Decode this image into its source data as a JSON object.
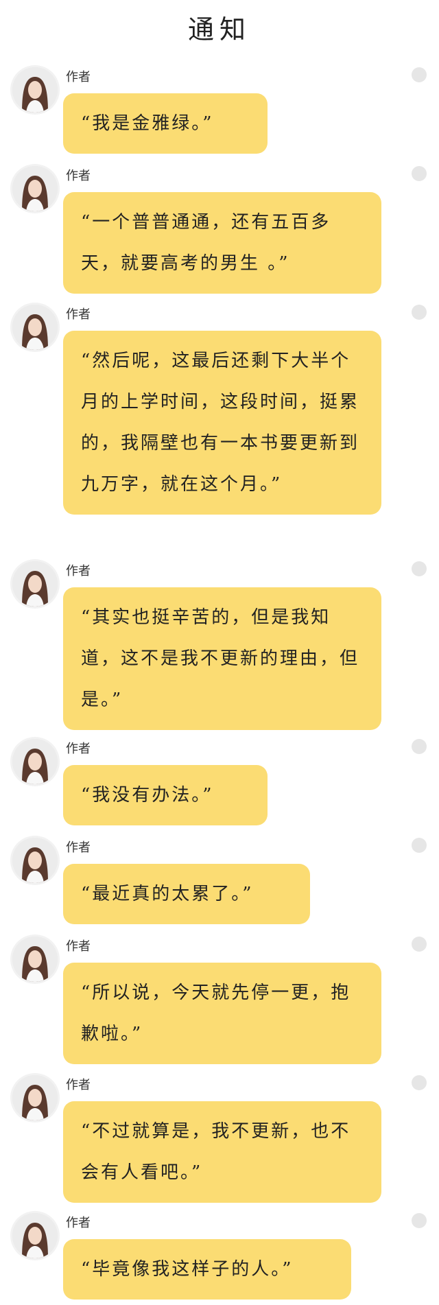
{
  "header": {
    "title": "通知"
  },
  "messages": [
    {
      "sender": "作者",
      "text": "“我是金雅绿。”"
    },
    {
      "sender": "作者",
      "text": "“一个普普通通，还有五百多天，就要高考的男生 。”"
    },
    {
      "sender": "作者",
      "text": "“然后呢，这最后还剩下大半个月的上学时间，这段时间，挺累的，我隔壁也有一本书要更新到九万字，就在这个月。”"
    },
    {
      "sender": "作者",
      "text": "“其实也挺辛苦的，但是我知道，这不是我不更新的理由，但是。”"
    },
    {
      "sender": "作者",
      "text": "“我没有办法。”"
    },
    {
      "sender": "作者",
      "text": "“最近真的太累了。”"
    },
    {
      "sender": "作者",
      "text": "“所以说，今天就先停一更，抱歉啦。”"
    },
    {
      "sender": "作者",
      "text": "“不过就算是，我不更新，也不会有人看吧。”"
    },
    {
      "sender": "作者",
      "text": "“毕竟像我这样子的人。”"
    }
  ]
}
